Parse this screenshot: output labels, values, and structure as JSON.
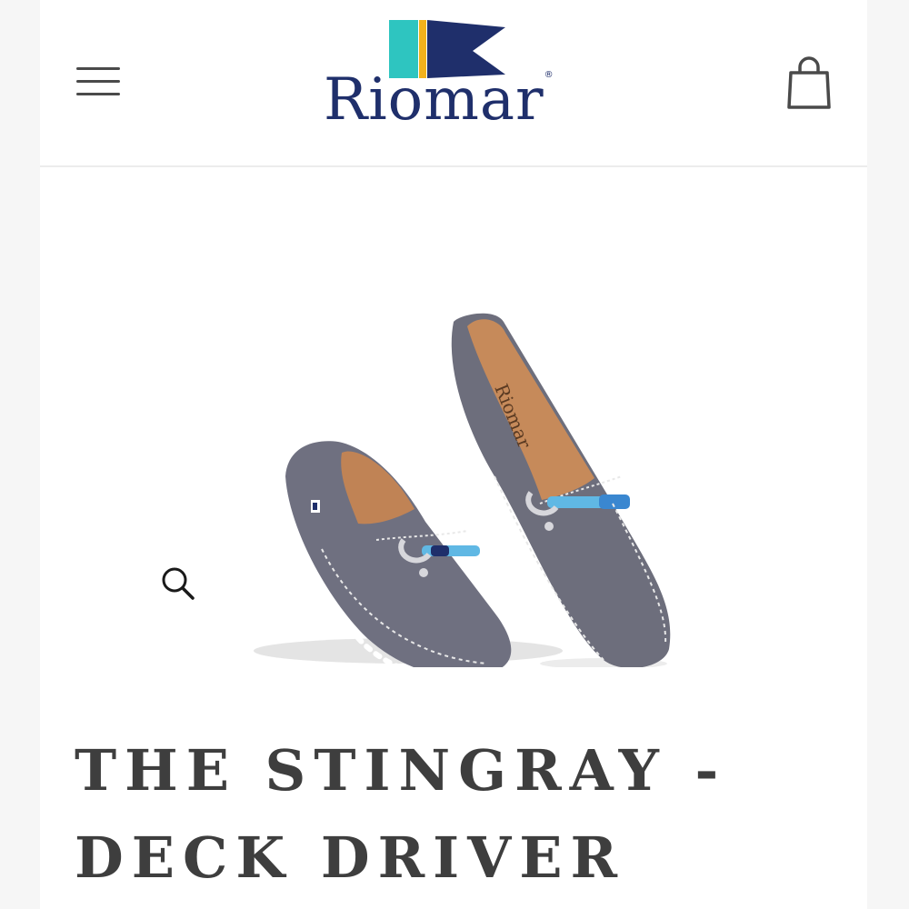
{
  "header": {
    "brand": "Riomar",
    "brand_mark": "®",
    "menu_icon": "hamburger-menu-icon",
    "cart_icon": "shopping-bag-icon"
  },
  "brand_colors": {
    "navy": "#1f2f6b",
    "teal": "#2ec5c0",
    "gold": "#f2b21c"
  },
  "product": {
    "image_alt": "Grey suede Riomar deck driver loafers with shackle buckle",
    "image_print": "Riomar",
    "zoom_icon": "magnifier-icon",
    "title": "THE STINGRAY - DECK DRIVER"
  }
}
